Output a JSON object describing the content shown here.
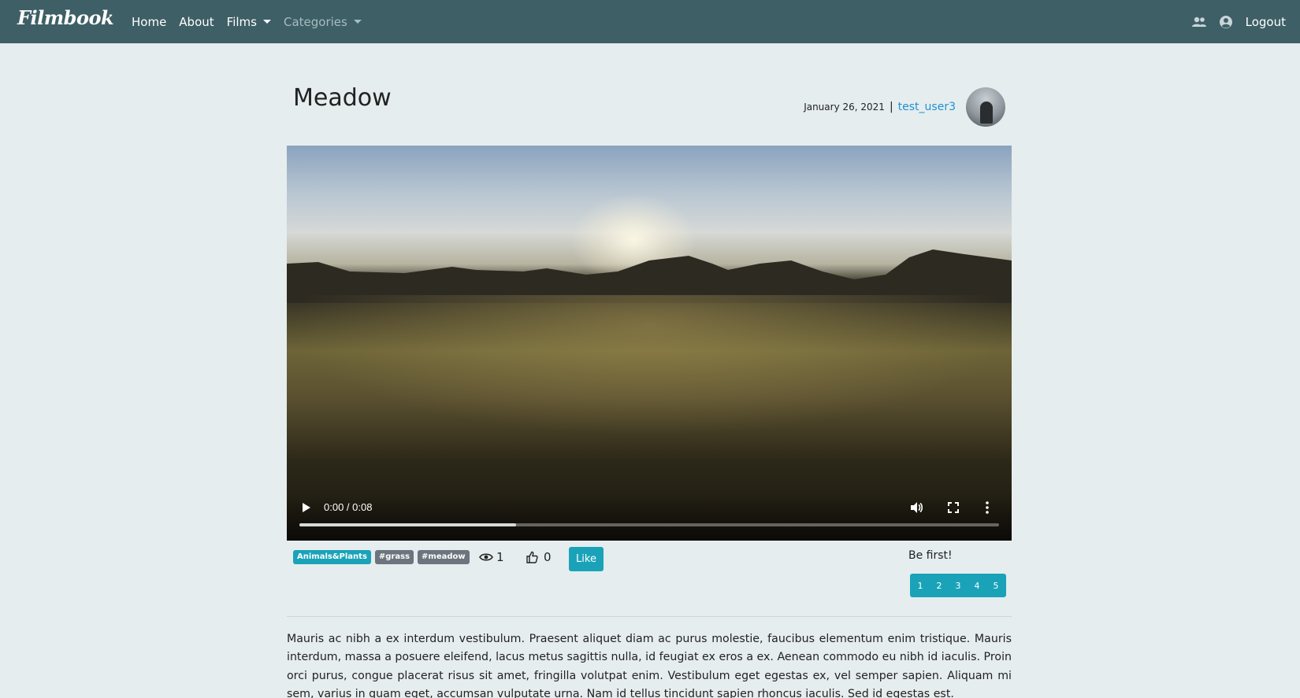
{
  "navbar": {
    "brand": "Filmbook",
    "links": [
      {
        "label": "Home"
      },
      {
        "label": "About"
      },
      {
        "label": "Films"
      },
      {
        "label": "Categories"
      }
    ],
    "logout": "Logout",
    "icons": [
      "users-icon",
      "user-circle-icon"
    ],
    "background": "#3e5f66"
  },
  "film": {
    "title": "Meadow",
    "date": "January 26, 2021",
    "separator": "|",
    "author": "test_user3",
    "video": {
      "time": "0:00 / 0:08",
      "buffered_fraction": 0.31
    },
    "tags": [
      "Animals&Plants",
      "#grass",
      "#meadow"
    ],
    "views": "1",
    "likes": "0",
    "like_label": "Like",
    "rating_prompt": "Be first!",
    "rating_options": [
      "1",
      "2",
      "3",
      "4",
      "5"
    ],
    "description": "Mauris ac nibh a ex interdum vestibulum. Praesent aliquet diam ac purus molestie, faucibus elementum enim tristique. Mauris interdum, massa a posuere eleifend, lacus metus sagittis nulla, id feugiat ex eros a ex. Aenean commodo eu nibh id iaculis. Proin orci purus, congue placerat risus sit amet, fringilla volutpat enim. Vestibulum eget egestas ex, vel semper sapien. Aliquam mi sem, varius in quam eget, accumsan vulputate urna. Nam id tellus tincidunt sapien rhoncus iaculis. Sed id egestas est."
  },
  "colors": {
    "accent": "#1aa3b8",
    "secondary": "#6c757d",
    "link": "#1e90d6",
    "page_bg": "#e6edee"
  }
}
